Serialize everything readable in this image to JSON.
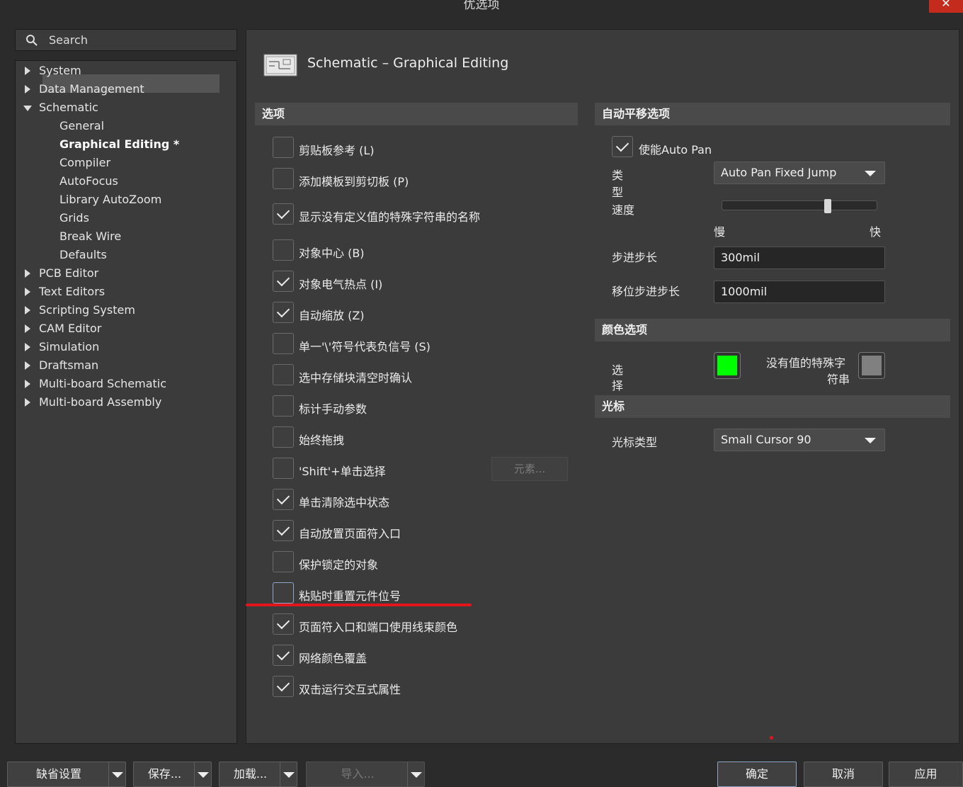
{
  "window": {
    "title": "优选项",
    "close": "✕"
  },
  "search": {
    "placeholder": "Search"
  },
  "tree": [
    {
      "label": "System",
      "level": 0,
      "state": "collapsed"
    },
    {
      "label": "Data Management",
      "level": 0,
      "state": "collapsed"
    },
    {
      "label": "Schematic",
      "level": 0,
      "state": "expanded"
    },
    {
      "label": "General",
      "level": 1
    },
    {
      "label": "Graphical Editing *",
      "level": 1,
      "selected": true
    },
    {
      "label": "Compiler",
      "level": 1
    },
    {
      "label": "AutoFocus",
      "level": 1
    },
    {
      "label": "Library AutoZoom",
      "level": 1
    },
    {
      "label": "Grids",
      "level": 1
    },
    {
      "label": "Break Wire",
      "level": 1
    },
    {
      "label": "Defaults",
      "level": 1
    },
    {
      "label": "PCB Editor",
      "level": 0,
      "state": "collapsed"
    },
    {
      "label": "Text Editors",
      "level": 0,
      "state": "collapsed"
    },
    {
      "label": "Scripting System",
      "level": 0,
      "state": "collapsed"
    },
    {
      "label": "CAM Editor",
      "level": 0,
      "state": "collapsed"
    },
    {
      "label": "Simulation",
      "level": 0,
      "state": "collapsed"
    },
    {
      "label": "Draftsman",
      "level": 0,
      "state": "collapsed"
    },
    {
      "label": "Multi-board Schematic",
      "level": 0,
      "state": "collapsed"
    },
    {
      "label": "Multi-board Assembly",
      "level": 0,
      "state": "collapsed"
    }
  ],
  "page_title": "Schematic – Graphical Editing",
  "options": {
    "header": "选项",
    "items": [
      {
        "label": "剪贴板参考 (L)",
        "checked": false
      },
      {
        "label": "添加模板到剪切板 (P)",
        "checked": false
      },
      {
        "label": "显示没有定义值的特殊字符串的名称",
        "checked": true
      },
      {
        "label": "对象中心 (B)",
        "checked": false
      },
      {
        "label": "对象电气热点 (I)",
        "checked": true
      },
      {
        "label": "自动缩放 (Z)",
        "checked": true
      },
      {
        "label": "单一'\\'符号代表负信号 (S)",
        "checked": false
      },
      {
        "label": "选中存储块清空时确认",
        "checked": false
      },
      {
        "label": "标计手动参数",
        "checked": false
      },
      {
        "label": "始终拖拽",
        "checked": false
      },
      {
        "label": "'Shift'+单击选择",
        "checked": false
      },
      {
        "label": "单击清除选中状态",
        "checked": true
      },
      {
        "label": "自动放置页面符入口",
        "checked": true
      },
      {
        "label": "保护锁定的对象",
        "checked": false
      },
      {
        "label": "粘贴时重置元件位号",
        "checked": false,
        "focused": true
      },
      {
        "label": "页面符入口和端口使用线束颜色",
        "checked": true
      },
      {
        "label": "网络颜色覆盖",
        "checked": true
      },
      {
        "label": "双击运行交互式属性",
        "checked": true
      }
    ],
    "elements_button": "元素..."
  },
  "autopan": {
    "header": "自动平移选项",
    "enable_label": "使能Auto Pan",
    "enable_checked": true,
    "type_label_1": "类",
    "type_label_2": "型",
    "type_value": "Auto Pan Fixed Jump",
    "speed_label": "速度",
    "speed_fraction": 0.68,
    "slow": "慢",
    "fast": "快",
    "step_label": "步进步长",
    "step_value": "300mil",
    "shift_step_label": "移位步进步长",
    "shift_step_value": "1000mil"
  },
  "colors": {
    "header": "颜色选项",
    "select_label_1": "选",
    "select_label_2": "择",
    "select_color": "#00ff00",
    "nostring_label_1": "没有值的特殊字",
    "nostring_label_2": "符串",
    "nostring_color": "#808080"
  },
  "cursor": {
    "header": "光标",
    "type_label": "光标类型",
    "type_value": "Small Cursor 90"
  },
  "footer": {
    "defaults": "缺省设置",
    "save": "保存...",
    "load": "加载...",
    "import": "导入...",
    "ok": "确定",
    "cancel": "取消",
    "apply": "应用"
  }
}
